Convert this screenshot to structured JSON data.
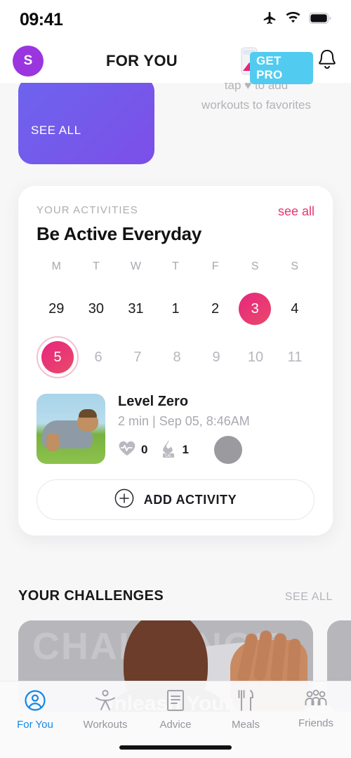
{
  "status_bar": {
    "time": "09:41",
    "icons": [
      "airplane-mode-icon",
      "wifi-icon",
      "battery-icon"
    ]
  },
  "nav": {
    "avatar_initial": "S",
    "title": "FOR YOU",
    "pro_label": "GET PRO",
    "hourglass_icon": "hourglass-icon",
    "bell_icon": "bell-icon"
  },
  "top_row": {
    "see_all_card_label": "SEE ALL",
    "favorites_hint_line1": "tap ♥ to add",
    "favorites_hint_line2": "workouts to favorites"
  },
  "activities": {
    "kicker": "YOUR ACTIVITIES",
    "see_all": "see all",
    "title": "Be Active Everyday",
    "calendar": {
      "day_labels": [
        "M",
        "T",
        "W",
        "T",
        "F",
        "S",
        "S"
      ],
      "week1": [
        {
          "num": "29",
          "state": "normal"
        },
        {
          "num": "30",
          "state": "normal"
        },
        {
          "num": "31",
          "state": "normal"
        },
        {
          "num": "1",
          "state": "normal"
        },
        {
          "num": "2",
          "state": "normal"
        },
        {
          "num": "3",
          "state": "active"
        },
        {
          "num": "4",
          "state": "normal"
        }
      ],
      "week2": [
        {
          "num": "5",
          "state": "active-ring"
        },
        {
          "num": "6",
          "state": "muted"
        },
        {
          "num": "7",
          "state": "muted"
        },
        {
          "num": "8",
          "state": "muted"
        },
        {
          "num": "9",
          "state": "muted"
        },
        {
          "num": "10",
          "state": "muted"
        },
        {
          "num": "11",
          "state": "muted"
        }
      ]
    },
    "entry": {
      "thumbnail": "pushup-photo",
      "title": "Level Zero",
      "meta": "2 min  |  Sep 05, 8:46AM",
      "heart_icon": "heart-rate-icon",
      "heart_value": "0",
      "calorie_icon": "flame-calorie-icon",
      "calorie_value": "1"
    },
    "add_button": {
      "icon": "plus-circle-icon",
      "label": "ADD ACTIVITY"
    }
  },
  "challenges": {
    "title": "YOUR CHALLENGES",
    "see_all": "SEE ALL",
    "card_watermark": "CHALLENGE",
    "card_caption": "Unleash Your"
  },
  "tabbar": {
    "items": [
      {
        "label": "For You",
        "icon": "person-circle-icon",
        "active": true
      },
      {
        "label": "Workouts",
        "icon": "stretching-person-icon",
        "active": false
      },
      {
        "label": "Advice",
        "icon": "document-icon",
        "active": false
      },
      {
        "label": "Meals",
        "icon": "fork-knife-icon",
        "active": false
      },
      {
        "label": "Friends",
        "icon": "people-group-icon",
        "active": false
      }
    ]
  },
  "colors": {
    "accent_pink": "#e8257f",
    "accent_blue": "#1388e8",
    "pro_cyan": "#52cbf0",
    "avatar_purple": "#9b35e0",
    "card_purple": "#6d64ee",
    "background": "#f7f7f8"
  }
}
